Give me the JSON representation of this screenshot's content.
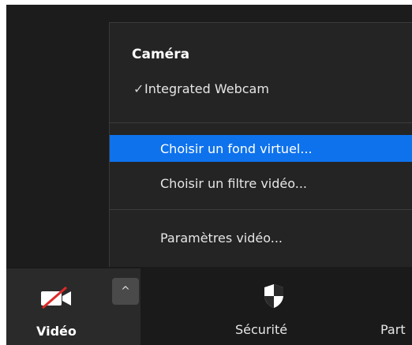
{
  "menu": {
    "header": "Caméra",
    "camera": {
      "check": "✓",
      "label": "Integrated Webcam"
    },
    "items": [
      {
        "label": "Choisir un fond virtuel..."
      },
      {
        "label": "Choisir un filtre vidéo..."
      },
      {
        "label": "Paramètres vidéo..."
      }
    ]
  },
  "toolbar": {
    "video_label": "Vidéo",
    "security_label": "Sécurité",
    "share_label": "Part",
    "arrow_glyph": "^"
  },
  "colors": {
    "highlight": "#0e72ed",
    "menu_bg": "#242424",
    "toolbar_bg": "#1a1a1a",
    "video_slash": "#e02828"
  },
  "icons": {
    "video": "video-off-icon",
    "security": "shield-icon",
    "arrow": "chevron-up-icon",
    "check": "checkmark-icon"
  }
}
